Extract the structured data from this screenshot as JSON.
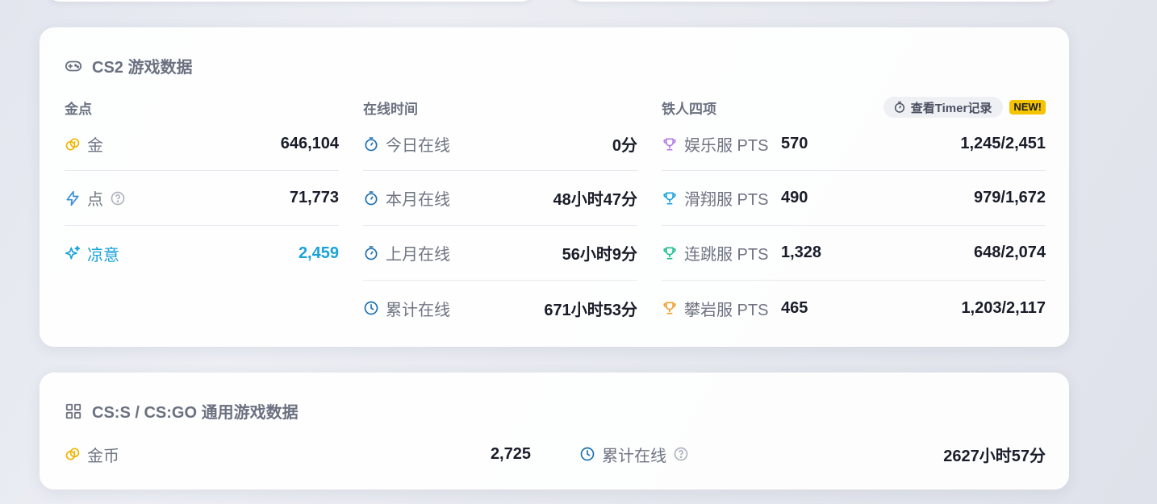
{
  "cs2": {
    "title": "CS2 游戏数据",
    "gold_col": {
      "header": "金点",
      "rows": [
        {
          "label": "金",
          "value": "646,104"
        },
        {
          "label": "点",
          "value": "71,773"
        },
        {
          "label": "凉意",
          "value": "2,459"
        }
      ]
    },
    "online_col": {
      "header": "在线时间",
      "rows": [
        {
          "label": "今日在线",
          "value": "0分"
        },
        {
          "label": "本月在线",
          "value": "48小时47分"
        },
        {
          "label": "上月在线",
          "value": "56小时9分"
        },
        {
          "label": "累计在线",
          "value": "671小时53分"
        }
      ]
    },
    "iron_col": {
      "header": "铁人四项",
      "timer_button": "查看Timer记录",
      "new_badge": "NEW!",
      "rows": [
        {
          "label": "娱乐服 PTS",
          "pts": "570",
          "ratio": "1,245/2,451",
          "color": "#b47be6"
        },
        {
          "label": "滑翔服 PTS",
          "pts": "490",
          "ratio": "979/1,672",
          "color": "#1aa3d9"
        },
        {
          "label": "连跳服 PTS",
          "pts": "1,328",
          "ratio": "648/2,074",
          "color": "#1fbf8f"
        },
        {
          "label": "攀岩服 PTS",
          "pts": "465",
          "ratio": "1,203/2,117",
          "color": "#f0a030"
        }
      ]
    }
  },
  "legacy": {
    "title": "CS:S / CS:GO 通用游戏数据",
    "gold": {
      "label": "金币",
      "value": "2,725"
    },
    "online": {
      "label": "累计在线",
      "value": "2627小时57分"
    }
  },
  "colors": {
    "gold_icon": "#f0b400",
    "accent_blue": "#1aa3d9",
    "clock_blue": "#1c6fb0"
  }
}
